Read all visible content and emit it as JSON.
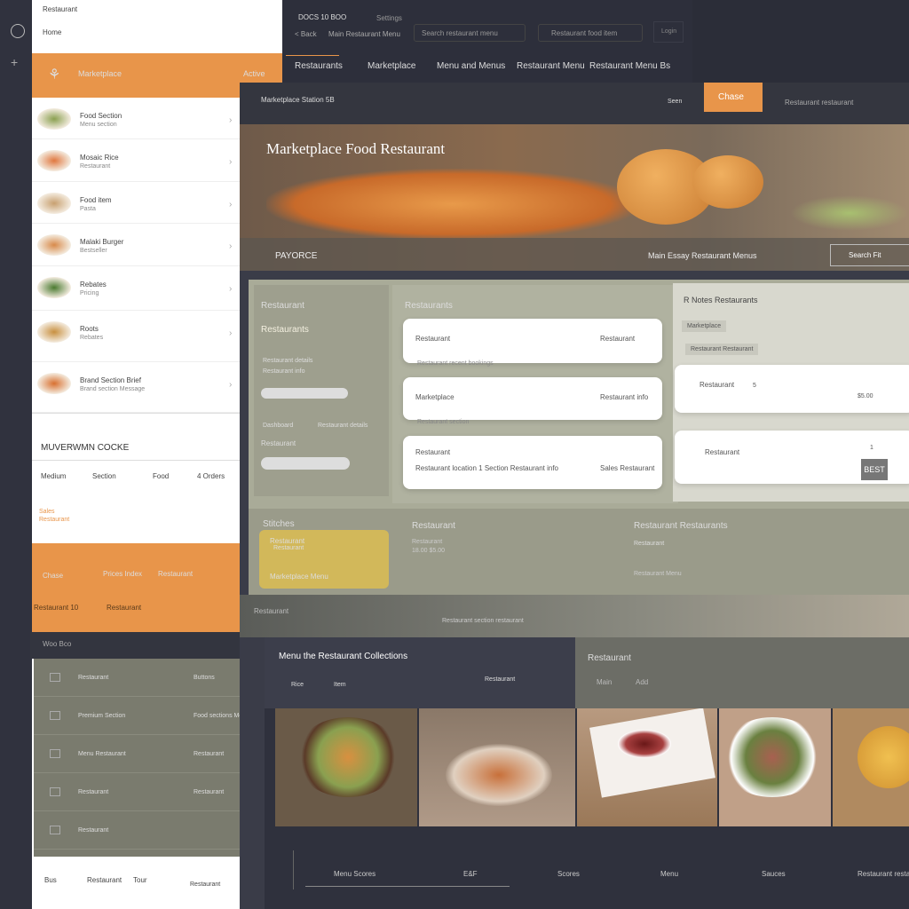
{
  "colors": {
    "accent": "#e8954a",
    "dark": "#2d2f3b",
    "olive": "#a9ab98",
    "gold": "#d2b85a"
  },
  "sidebar": {
    "top_label": "Restaurant",
    "sub_label": "Home",
    "active": {
      "label": "Marketplace",
      "badge": "Active"
    },
    "items": [
      {
        "title": "Food Section",
        "sub": "Menu section"
      },
      {
        "title": "Mosaic Rice",
        "sub": "Restaurant"
      },
      {
        "title": "Food item",
        "sub": "Pasta"
      },
      {
        "title": "Malaki Burger",
        "sub": "Bestseller"
      },
      {
        "title": "Rebates",
        "sub": "Pricing"
      },
      {
        "title": "Roots",
        "sub": "Rebates"
      },
      {
        "title": "Brand Section Brief",
        "sub": "Brand section Message"
      }
    ],
    "section_title": "MUVERWMN COCKE",
    "section_cols": [
      "Medium",
      "Section",
      "Food",
      "4 Orders"
    ],
    "section_note": "Sales",
    "section_note2": "Restaurant",
    "orange_row": [
      "Chase",
      "Prices Index",
      "Restaurant"
    ],
    "orange_row2": [
      "Restaurant 10",
      "Restaurant"
    ],
    "dark_label": "Woo Bco",
    "list": [
      {
        "a": "Restaurant",
        "b": "Buttons"
      },
      {
        "a": "Premium Section",
        "b": "Food sections Menu"
      },
      {
        "a": "Menu Restaurant",
        "b": "Restaurant"
      },
      {
        "a": "Restaurant",
        "b": "Restaurant"
      },
      {
        "a": "Restaurant",
        "b": ""
      }
    ],
    "footer": [
      "Bus",
      "Restaurant",
      "Tour",
      "Restaurant"
    ]
  },
  "topbar": {
    "title": "DOCS 10 BOO",
    "sub": "Settings",
    "back": "< Back",
    "tab": "Main Restaurant Menu",
    "search_placeholder": "Search restaurant menu",
    "field2": "Restaurant food item",
    "btn": "Login",
    "nav": [
      "Restaurants",
      "Marketplace",
      "Menu and Menus",
      "Restaurant Menu",
      "Restaurant Menu Bs"
    ]
  },
  "panel": {
    "title": "Marketplace Station 5B",
    "link": "Seen",
    "button": "Chase",
    "brand": "Restaurant restaurant",
    "hero": {
      "title": "Marketplace Food Restaurant",
      "sub": "PAYORCE",
      "caption": "Main Essay Restaurant Menus",
      "btn": "Search Fit"
    },
    "left": {
      "title": "Restaurant",
      "sub": "Restaurants",
      "lines": [
        "Restaurant details",
        "Restaurant info"
      ],
      "slider_label": "Restaurant",
      "row": [
        "Dashboard",
        "Restaurant details"
      ]
    },
    "mid": {
      "title": "Restaurants",
      "cards": [
        {
          "l": "Restaurant",
          "r": "Restaurant"
        },
        {
          "l": "Marketplace",
          "r": "Restaurant info"
        },
        {
          "l": "Restaurant",
          "desc": "Restaurant location 1 Section Restaurant info",
          "r": "Sales Restaurant"
        }
      ],
      "notes": [
        "Restaurant recent bookings",
        "Restaurant section"
      ]
    },
    "right": {
      "title": "R Notes Restaurants",
      "chips": [
        "Marketplace",
        "Restaurant Restaurant"
      ],
      "cards": [
        {
          "l": "Restaurant",
          "v": "5",
          "amt": "$5.00"
        },
        {
          "l": "Restaurant",
          "v": "1",
          "badge": "BEST"
        }
      ]
    },
    "bottom": {
      "a": "Stitches",
      "card": [
        "Restaurant",
        "Restaurant"
      ],
      "card2": "Marketplace Menu",
      "b": "Restaurant",
      "b_lines": [
        "Restaurant",
        "18.00 $5.00"
      ],
      "c": "Restaurant Restaurants",
      "c_lines": [
        "Restaurant",
        "Restaurant Menu"
      ]
    },
    "blur_label": "Restaurant",
    "blur_label2": "Restaurant section restaurant"
  },
  "gallery": {
    "title": "Menu the Restaurant Collections",
    "meta": [
      "Rice",
      "Item",
      "Restaurant"
    ],
    "right_title": "Restaurant",
    "right_items": [
      "Main",
      "Add"
    ],
    "tabs": [
      "Menu Scores",
      "E&F",
      "Scores",
      "Menu",
      "Sauces",
      "Restaurant restaurant"
    ]
  }
}
